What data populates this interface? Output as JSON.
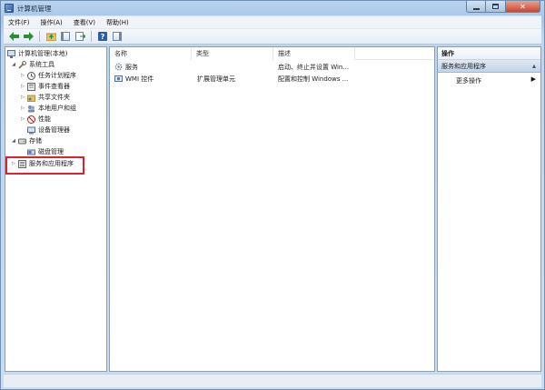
{
  "window": {
    "title": "计算机管理"
  },
  "menu": [
    {
      "label": "文件(F)"
    },
    {
      "label": "操作(A)"
    },
    {
      "label": "查看(V)"
    },
    {
      "label": "帮助(H)"
    }
  ],
  "toolbar": {
    "buttons": [
      "back-arrow-icon",
      "forward-arrow-icon",
      "up-folder-icon",
      "show-hide-tree-icon",
      "export-list-icon",
      "help-icon",
      "properties-icon"
    ]
  },
  "tree": {
    "root": "计算机管理(本地)",
    "system_tools": "系统工具",
    "task_scheduler": "任务计划程序",
    "event_viewer": "事件查看器",
    "shared_folders": "共享文件夹",
    "local_users": "本地用户和组",
    "performance": "性能",
    "device_manager": "设备管理器",
    "storage": "存储",
    "disk_management": "磁盘管理",
    "services_apps": "服务和应用程序"
  },
  "list": {
    "columns": [
      "名称",
      "类型",
      "描述"
    ],
    "rows": [
      {
        "name": "服务",
        "type": "",
        "desc": "启动、终止并设置 Win..."
      },
      {
        "name": "WMI 控件",
        "type": "扩展管理单元",
        "desc": "配置和控制 Windows ..."
      }
    ]
  },
  "actions": {
    "title": "操作",
    "section": "服务和应用程序",
    "more": "更多操作"
  },
  "colors": {
    "highlight": "#e0202a",
    "accent": "#2b5ea9"
  }
}
